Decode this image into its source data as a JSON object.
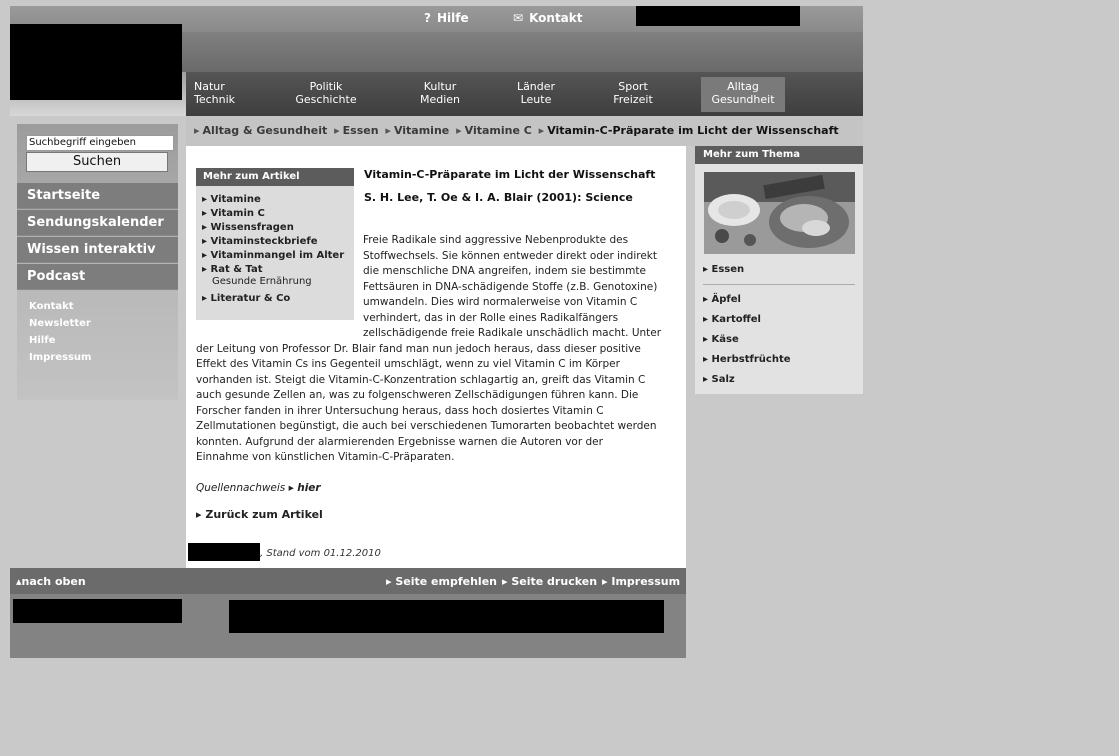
{
  "header": {
    "help": "Hilfe",
    "contact": "Kontakt",
    "nav": [
      {
        "l1": "Natur",
        "l2": "Technik"
      },
      {
        "l1": "Politik",
        "l2": "Geschichte"
      },
      {
        "l1": "Kultur",
        "l2": "Medien"
      },
      {
        "l1": "Länder",
        "l2": "Leute"
      },
      {
        "l1": "Sport",
        "l2": "Freizeit"
      },
      {
        "l1": "Alltag",
        "l2": "Gesundheit"
      }
    ]
  },
  "breadcrumb": [
    "Alltag & Gesundheit",
    "Essen",
    "Vitamine",
    "Vitamine C",
    "Vitamin-C-Präparate im Licht der Wissenschaft"
  ],
  "sidebar": {
    "search_placeholder": "Suchbegriff eingeben",
    "search_button": "Suchen",
    "main": [
      "Startseite",
      "Sendungskalender",
      "Wissen interaktiv",
      "Podcast"
    ],
    "sub": [
      "Kontakt",
      "Newsletter",
      "Hilfe",
      "Impressum"
    ]
  },
  "more_article": {
    "heading": "Mehr zum Artikel",
    "links": [
      "Vitamine",
      "Vitamin C",
      "Wissensfragen",
      "Vitaminsteckbriefe",
      "Vitaminmangel im Alter",
      "Rat & Tat"
    ],
    "rat_sub": "Gesunde Ernährung",
    "last": "Literatur & Co"
  },
  "article": {
    "title": "Vitamin-C-Präparate im Licht der Wissenschaft",
    "source": "S. H. Lee, T. Oe & I. A. Blair (2001): Science",
    "lines": [
      "Freie Radikale sind aggressive Nebenprodukte des",
      "Stoffwechsels. Sie können entweder direkt oder indirekt",
      "die menschliche DNA angreifen, indem sie bestimmte",
      "Fettsäuren in DNA-schädigende Stoffe (z.B. Genotoxine)",
      "umwandeln. Dies wird normalerweise von Vitamin C",
      "verhindert, das in der Rolle eines Radikalfängers",
      "zellschädigende freie Radikale unschädlich macht. Unter",
      "der Leitung von Professor Dr. Blair fand man nun jedoch heraus, dass dieser positive",
      "Effekt des Vitamin Cs ins Gegenteil umschlägt, wenn zu viel Vitamin C im Körper",
      "vorhanden ist. Steigt die Vitamin-C-Konzentration schlagartig an, greift das Vitamin C",
      "auch gesunde Zellen an, was zu folgenschweren Zellschädigungen führen kann. Die",
      "Forscher fanden in ihrer Untersuchung heraus, dass hoch dosiertes Vitamin C",
      "Zellmutationen begünstigt, die auch bei verschiedenen Tumorarten beobachtet werden",
      "konnten. Aufgrund der alarmierenden Ergebnisse warnen die Autoren vor der",
      "Einnahme von künstlichen Vitamin-C-Präparaten."
    ],
    "source_label": "Quellennachweis",
    "source_link": "hier",
    "back": "Zurück zum Artikel",
    "stand": ", Stand vom 01.12.2010"
  },
  "right": {
    "heading": "Mehr zum Thema",
    "first": "Essen",
    "links": [
      "Äpfel",
      "Kartoffel",
      "Käse",
      "Herbstfrüchte",
      "Salz"
    ]
  },
  "footer": {
    "top": "nach oben",
    "recommend": "Seite empfehlen",
    "print": "Seite drucken",
    "imprint": "Impressum"
  }
}
